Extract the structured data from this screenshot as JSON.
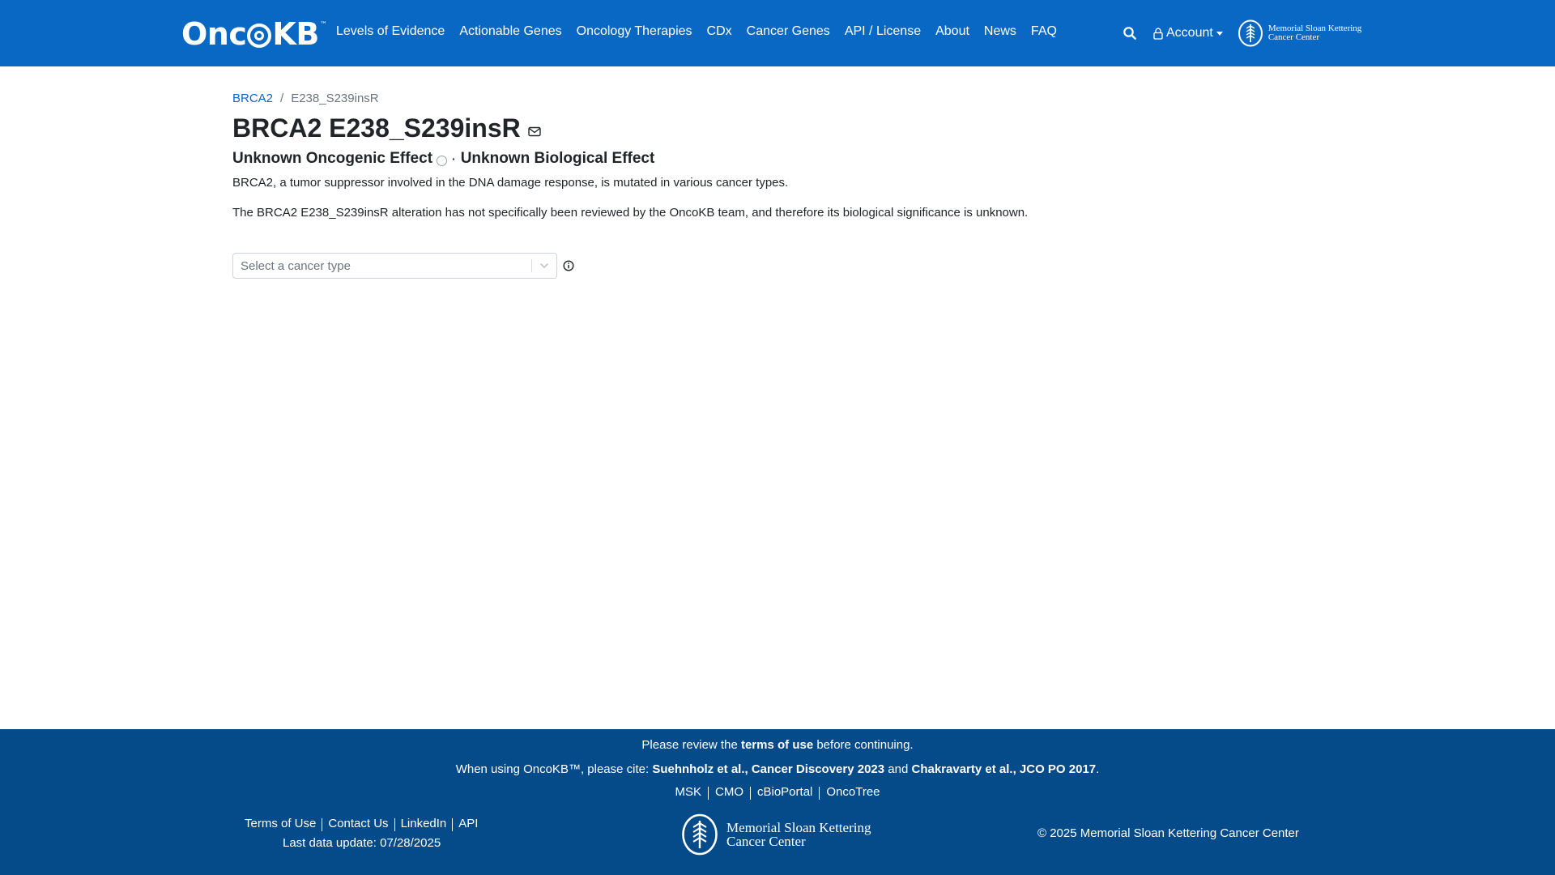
{
  "nav": {
    "brand": "Onc",
    "brand_tail": "KB",
    "brand_tm": "™",
    "links": [
      "Levels of Evidence",
      "Actionable Genes",
      "Oncology Therapies",
      "CDx",
      "Cancer Genes",
      "API / License",
      "About",
      "News",
      "FAQ"
    ],
    "account_label": "Account",
    "msk_line1": "Memorial Sloan Kettering",
    "msk_line2": "Cancer Center"
  },
  "breadcrumb": {
    "gene": "BRCA2",
    "separator": "/",
    "alteration": "E238_S239insR"
  },
  "page": {
    "title": "BRCA2 E238_S239insR",
    "oncogenic_effect": "Unknown Oncogenic Effect",
    "dot": "·",
    "biological_effect": "Unknown Biological Effect",
    "gene_summary": "BRCA2, a tumor suppressor involved in the DNA damage response, is mutated in various cancer types.",
    "alteration_summary": "The BRCA2 E238_S239insR alteration has not specifically been reviewed by the OncoKB team, and therefore its biological significance is unknown."
  },
  "cancer_type_select": {
    "placeholder": "Select a cancer type"
  },
  "footer": {
    "review_pre": "Please review the ",
    "review_link": "terms of use",
    "review_post": " before continuing.",
    "cite_pre": "When using OncoKB™, please cite: ",
    "cite_1": "Suehnholz et al., Cancer Discovery 2023",
    "cite_and": " and ",
    "cite_2": "Chakravarty et al., JCO PO 2017",
    "cite_end": ".",
    "center_links": [
      "MSK",
      "CMO",
      "cBioPortal",
      "OncoTree"
    ],
    "left_links": [
      "Terms of Use",
      "Contact Us",
      "LinkedIn",
      "API"
    ],
    "last_update": "Last data update: 07/28/2025",
    "msk_line1": "Memorial Sloan Kettering",
    "msk_line2": "Cancer Center",
    "copyright": "© 2025 Memorial Sloan Kettering Cancer Center"
  },
  "colors": {
    "nav_bg": "#0968c3",
    "footer_bg": "#054a89",
    "link": "#0968c3"
  }
}
